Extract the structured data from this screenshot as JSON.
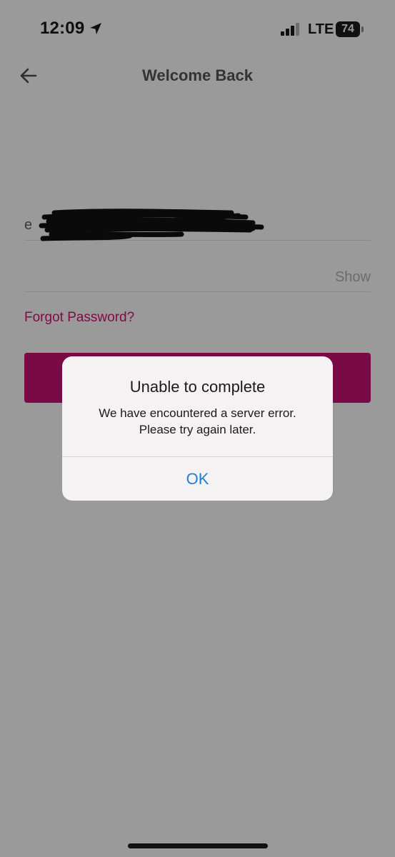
{
  "status_bar": {
    "time": "12:09",
    "network": "LTE",
    "battery": "74"
  },
  "header": {
    "title": "Welcome Back"
  },
  "form": {
    "email_value": "e",
    "password_toggle_label": "Show",
    "forgot_password_label": "Forgot Password?"
  },
  "alert": {
    "title": "Unable to complete",
    "message_line1": "We have encountered a server error.",
    "message_line2": "Please try again later.",
    "ok_label": "OK"
  },
  "colors": {
    "accent": "#7a0a45",
    "link": "#7d0b45",
    "alert_button": "#1f7ed9",
    "overlay_background": "#9a9a9a"
  },
  "icons": {
    "location": "location-arrow-icon",
    "signal": "signal-bars-icon",
    "battery": "battery-icon",
    "back": "back-arrow-icon"
  }
}
